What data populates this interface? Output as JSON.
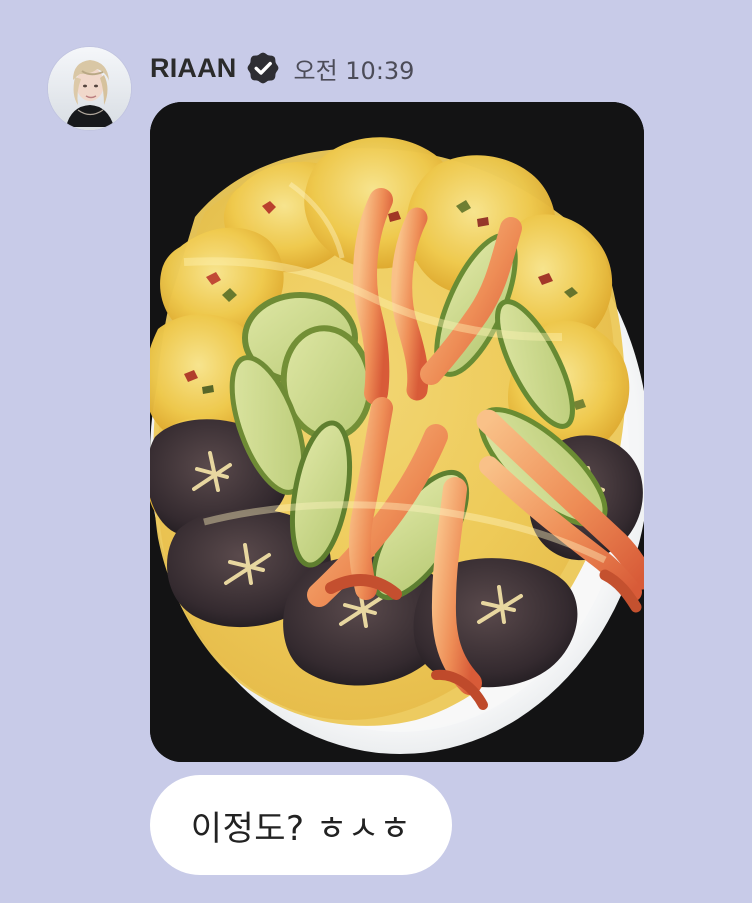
{
  "message": {
    "sender_name": "RIAAN",
    "sender_verified": true,
    "timestamp": "오전 10:39",
    "text": "이정도? ㅎㅅㅎ",
    "photo_subject": "plate of Korean fried jeon with shrimp, zucchini and shiitake mushrooms"
  },
  "icons": {
    "verified": "verified-badge-icon",
    "avatar": "profile-avatar"
  },
  "colors": {
    "background": "#c8cbe8",
    "bubble": "#ffffff",
    "sender": "#2b2b2b",
    "timestamp": "#4c4c58"
  }
}
